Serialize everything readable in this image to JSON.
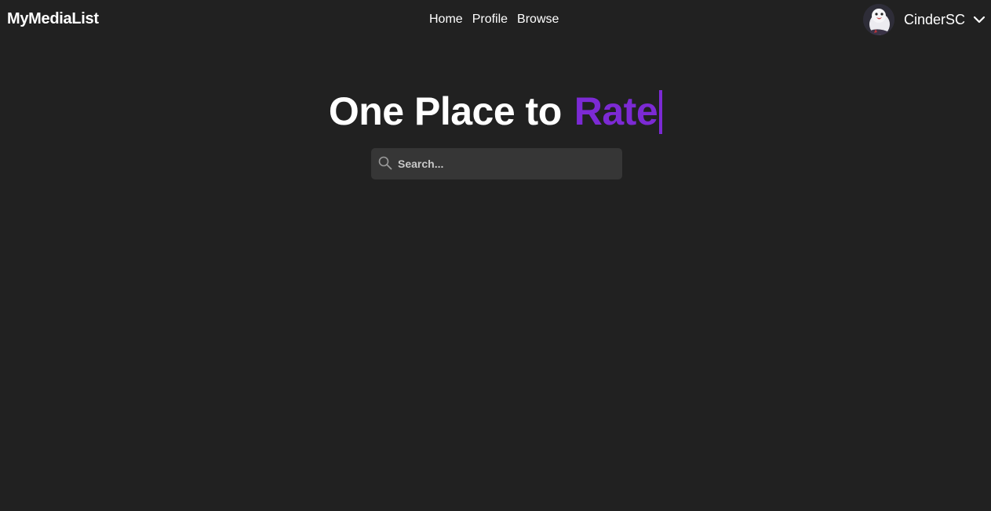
{
  "brand": {
    "title": "MyMediaList"
  },
  "nav": {
    "links": [
      {
        "label": "Home"
      },
      {
        "label": "Profile"
      },
      {
        "label": "Browse"
      }
    ]
  },
  "user": {
    "name": "CinderSC",
    "avatar_icon": "penguin-avatar-icon",
    "menu_icon": "chevron-down-icon"
  },
  "hero": {
    "static_text": "One Place to",
    "animated_word": "Rate"
  },
  "search": {
    "placeholder": "Search...",
    "value": "",
    "icon": "search-icon"
  },
  "colors": {
    "background": "#212121",
    "accent": "#7c2ad4",
    "search_bg": "#363636",
    "text": "#ffffff"
  }
}
